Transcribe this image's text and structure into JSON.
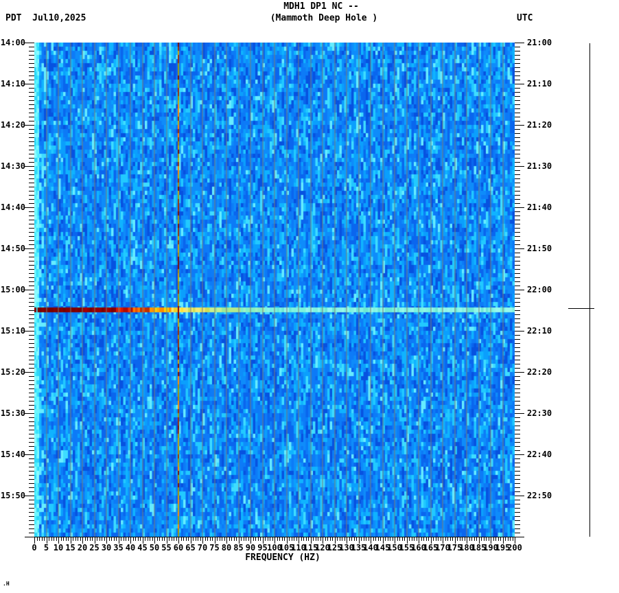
{
  "header": {
    "title_line1": "MDH1 DP1 NC --",
    "title_line2": "(Mammoth Deep Hole )",
    "left_timezone": "PDT",
    "date": "Jul10,2025",
    "right_timezone": "UTC"
  },
  "watermark": ".H",
  "chart_data": {
    "type": "heatmap",
    "subtype": "seismic-spectrogram",
    "title": "MDH1 DP1 NC -- (Mammoth Deep Hole )",
    "station": "MDH1 DP1 NC",
    "xlabel": "FREQUENCY (HZ)",
    "x_axis": {
      "min_hz": 0,
      "max_hz": 200,
      "major_tick_hz": 5,
      "minor_tick_hz": 1,
      "labels": [
        "0",
        "5",
        "10",
        "15",
        "20",
        "25",
        "30",
        "35",
        "40",
        "45",
        "50",
        "55",
        "60",
        "65",
        "70",
        "75",
        "80",
        "85",
        "90",
        "95",
        "100",
        "105",
        "110",
        "115",
        "120",
        "125",
        "130",
        "135",
        "140",
        "145",
        "150",
        "155",
        "160",
        "165",
        "170",
        "175",
        "180",
        "185",
        "190",
        "195",
        "200"
      ]
    },
    "y_axis_left": {
      "timezone": "PDT",
      "start": "14:00",
      "end": "16:00",
      "major_tick_minutes": 10,
      "minor_tick_minutes": 1,
      "labels": [
        "14:00",
        "14:10",
        "14:20",
        "14:30",
        "14:40",
        "14:50",
        "15:00",
        "15:10",
        "15:20",
        "15:30",
        "15:40",
        "15:50"
      ]
    },
    "y_axis_right": {
      "timezone": "UTC",
      "start": "21:00",
      "end": "23:00",
      "major_tick_minutes": 10,
      "minor_tick_minutes": 1,
      "labels": [
        "21:00",
        "21:10",
        "21:20",
        "21:30",
        "21:40",
        "21:50",
        "22:00",
        "22:10",
        "22:20",
        "22:30",
        "22:40",
        "22:50"
      ]
    },
    "gridlines_every_hz": 5,
    "features": [
      {
        "name": "background-noise",
        "description": "speckled blue noise across all frequencies and times"
      },
      {
        "name": "broadband-event-band",
        "time_pdt": "15:04",
        "time_utc": "22:04",
        "minute_offset": 64.3,
        "freq_range_hz": [
          0,
          200
        ],
        "description": "horizontal earthquake band: dark red below ~33 Hz grading through orange and yellow near 40-65 Hz to pale cyan above ~95 Hz"
      },
      {
        "name": "power-line-hum",
        "freq_hz": 60,
        "description": "vertical olive/orange/dark-red line at 60 Hz for full duration"
      },
      {
        "name": "microseism-line",
        "freq_hz": 1,
        "description": "bright cyan vertical line near 1 Hz for full duration"
      },
      {
        "name": "right-scale-marker",
        "description": "vertical line at far right with horizontal crosshair at event time 22:04 UTC"
      }
    ],
    "colors": {
      "noise_palette": [
        "#0752e0",
        "#0a66ee",
        "#0d7bf7",
        "#0f8cfa",
        "#0b9ffd",
        "#10b3ff",
        "#22c9ff",
        "#3fdcff",
        "#66ecff"
      ],
      "noise_weights": [
        0.1,
        0.16,
        0.2,
        0.16,
        0.12,
        0.1,
        0.08,
        0.05,
        0.03
      ],
      "lowfreq_palette": [
        "#49eeff",
        "#6ef7ff",
        "#2fd8f8",
        "#8bfbff"
      ],
      "event_band_low_hz": "#7b0000",
      "event_band_mid_hz": "#ffd000",
      "event_band_high_hz": "#7cf3dc",
      "hum_palette": [
        "#b08d00",
        "#c7a60b",
        "#9c9a12",
        "#ff8c00",
        "#a03000",
        "#7d0e00"
      ],
      "gridline": "#7d7d73",
      "axis": "#000000",
      "background": "#ffffff"
    }
  }
}
